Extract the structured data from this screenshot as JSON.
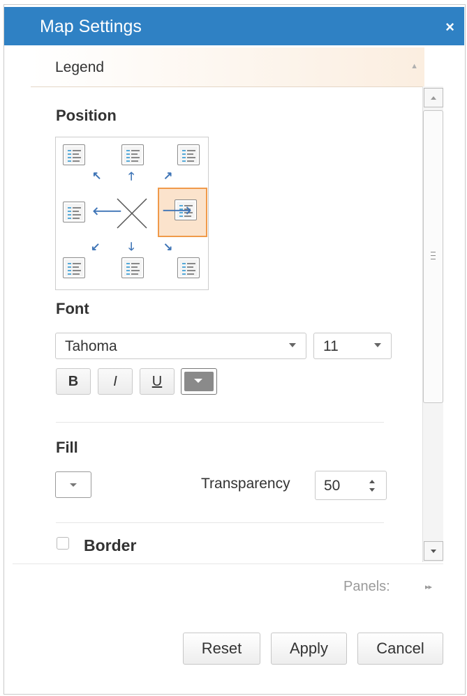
{
  "dialog": {
    "title": "Map Settings",
    "close_icon": "×"
  },
  "legend_panel": {
    "label": "Legend",
    "caret": "▲"
  },
  "position": {
    "title": "Position",
    "selected": "right"
  },
  "font": {
    "title": "Font",
    "family": "Tahoma",
    "size": "11",
    "bold_label": "B",
    "italic_label": "I",
    "underline_label": "U"
  },
  "fill": {
    "title": "Fill",
    "transparency_label": "Transparency",
    "transparency_value": "50"
  },
  "border": {
    "label": "Border",
    "checked": false
  },
  "panels": {
    "label": "Panels:",
    "arrow": "▸▸"
  },
  "buttons": {
    "reset": "Reset",
    "apply": "Apply",
    "cancel": "Cancel"
  },
  "colors": {
    "title_bar": "#2f81c4",
    "selected_cell": "#fbe3cc",
    "selected_border": "#f09a4a",
    "arrow": "#3e74b6"
  }
}
